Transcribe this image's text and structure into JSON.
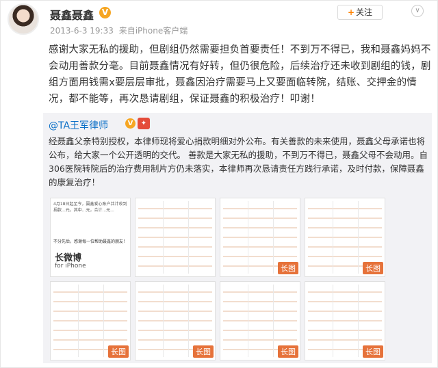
{
  "post": {
    "author": "聂鑫聂鑫",
    "verified_badge": "V",
    "timestamp": "2013-6-3 19:33",
    "source_prefix": "来自",
    "source": "iPhone客户端",
    "follow_plus": "+",
    "follow_label": "关注",
    "more_glyph": "∨",
    "text": "感谢大家无私的援助，但剧组仍然需要担负首要责任！不到万不得已，我和聂鑫妈妈不会动用善款分毫。目前聂鑫情况有好转，但仍很危险，后续治疗还未收到剧组的钱，剧组方面用钱需x要层层审批，聂鑫因治疗需要马上又要面临转院，结账、交押金的情况，都不能等，再次恳请剧组，保证聂鑫的积极治疗！叩谢！"
  },
  "repost": {
    "author": "@TA王军律师",
    "verified_badge": "V",
    "badge": "🎁",
    "text": "经聂鑫父亲特别授权，本律师现将爱心捐款明细对外公布。有关善款的未来使用，聂鑫父母承诺也将公布，给大家一个公开透明的交代。 善款是大家无私的援助，不到万不得已，聂鑫父母不会动用。自306医院转院后的治疗费用制片方仍未落实，本律师再次恳请责任方践行承诺，及时付款，保障聂鑫的康复治疗！",
    "first_image": {
      "text": "4月18日起至今，聂鑫爱心账户共计收到捐款...元，其中...元，合计...元...",
      "cta": "不分先后，感谢每一位帮助聂鑫的朋友！",
      "brand": "长微博",
      "brand_sub": "for iPhone"
    },
    "long_image_tag": "长图"
  }
}
